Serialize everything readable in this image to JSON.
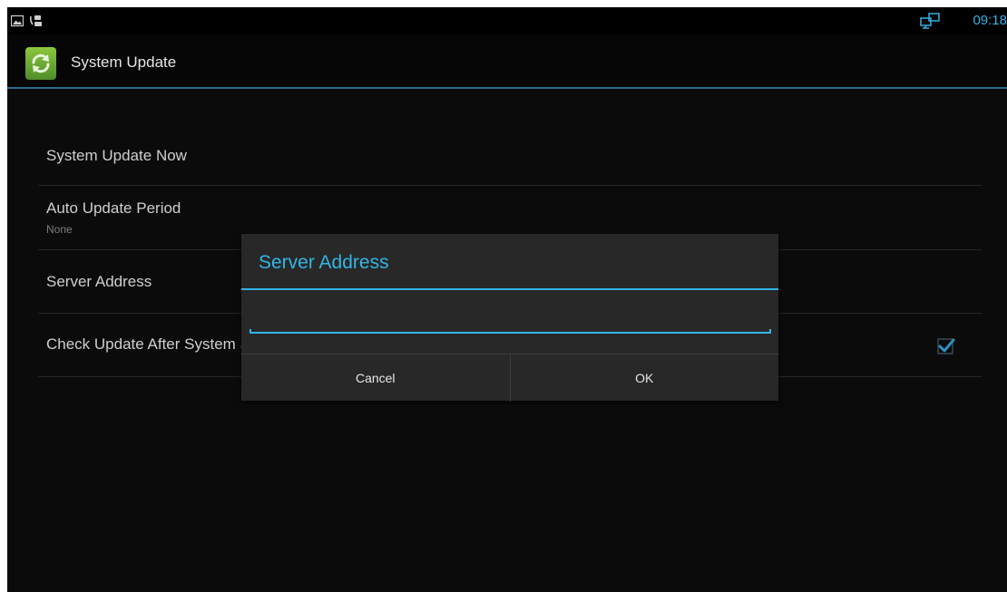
{
  "status_bar": {
    "time": "09:18",
    "left_icons": [
      "image-icon",
      "phone-headset-icon"
    ],
    "right_icons": [
      "network-computers-icon"
    ]
  },
  "action_bar": {
    "title": "System Update",
    "app_icon": "refresh-icon"
  },
  "preferences": [
    {
      "title": "System Update Now"
    },
    {
      "title": "Auto Update Period",
      "summary": "None"
    },
    {
      "title": "Server Address"
    },
    {
      "title": "Check Update After System Start",
      "checked": true
    }
  ],
  "dialog": {
    "title": "Server Address",
    "input_value": "",
    "cancel_label": "Cancel",
    "ok_label": "OK"
  },
  "colors": {
    "accent": "#33b5e5",
    "background": "#0b0b0b",
    "dialog_background": "#282828",
    "app_icon_green": "#6aab35"
  }
}
